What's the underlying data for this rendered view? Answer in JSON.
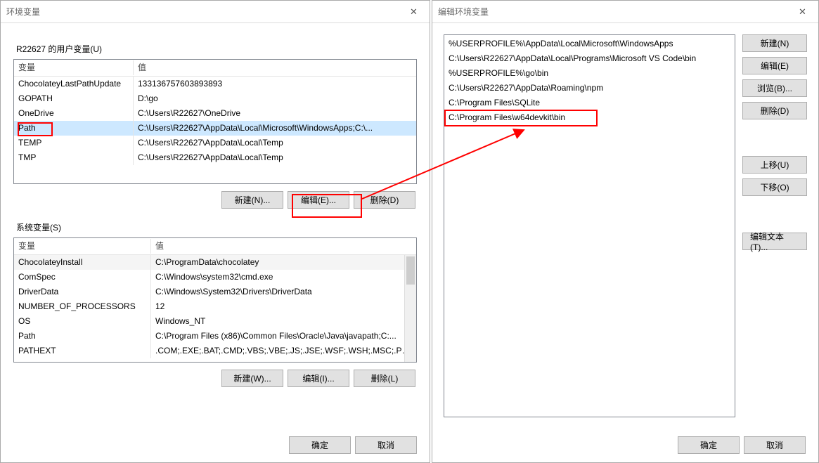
{
  "left_dialog": {
    "title": "环境变量",
    "user_group_label": "R22627 的用户变量(U)",
    "sys_group_label": "系统变量(S)",
    "columns": {
      "var": "变量",
      "val": "值"
    },
    "user_vars": [
      {
        "name": "ChocolateyLastPathUpdate",
        "value": "133136757603893893"
      },
      {
        "name": "GOPATH",
        "value": "D:\\go"
      },
      {
        "name": "OneDrive",
        "value": "C:\\Users\\R22627\\OneDrive"
      },
      {
        "name": "Path",
        "value": "C:\\Users\\R22627\\AppData\\Local\\Microsoft\\WindowsApps;C:\\..."
      },
      {
        "name": "TEMP",
        "value": "C:\\Users\\R22627\\AppData\\Local\\Temp"
      },
      {
        "name": "TMP",
        "value": "C:\\Users\\R22627\\AppData\\Local\\Temp"
      }
    ],
    "sys_vars": [
      {
        "name": "ChocolateyInstall",
        "value": "C:\\ProgramData\\chocolatey"
      },
      {
        "name": "ComSpec",
        "value": "C:\\Windows\\system32\\cmd.exe"
      },
      {
        "name": "DriverData",
        "value": "C:\\Windows\\System32\\Drivers\\DriverData"
      },
      {
        "name": "NUMBER_OF_PROCESSORS",
        "value": "12"
      },
      {
        "name": "OS",
        "value": "Windows_NT"
      },
      {
        "name": "Path",
        "value": "C:\\Program Files (x86)\\Common Files\\Oracle\\Java\\javapath;C:..."
      },
      {
        "name": "PATHEXT",
        "value": ".COM;.EXE;.BAT;.CMD;.VBS;.VBE;.JS;.JSE;.WSF;.WSH;.MSC;.PY;.P..."
      }
    ],
    "user_btns": {
      "new": "新建(N)...",
      "edit": "编辑(E)...",
      "delete": "删除(D)"
    },
    "sys_btns": {
      "new": "新建(W)...",
      "edit": "编辑(I)...",
      "delete": "删除(L)"
    },
    "ok": "确定",
    "cancel": "取消"
  },
  "right_dialog": {
    "title": "编辑环境变量",
    "paths": [
      "%USERPROFILE%\\AppData\\Local\\Microsoft\\WindowsApps",
      "C:\\Users\\R22627\\AppData\\Local\\Programs\\Microsoft VS Code\\bin",
      "%USERPROFILE%\\go\\bin",
      "C:\\Users\\R22627\\AppData\\Roaming\\npm",
      "C:\\Program Files\\SQLite",
      "C:\\Program Files\\w64devkit\\bin"
    ],
    "btns": {
      "new": "新建(N)",
      "edit": "编辑(E)",
      "browse": "浏览(B)...",
      "delete": "删除(D)",
      "up": "上移(U)",
      "down": "下移(O)",
      "edit_text": "编辑文本(T)..."
    },
    "ok": "确定",
    "cancel": "取消"
  }
}
